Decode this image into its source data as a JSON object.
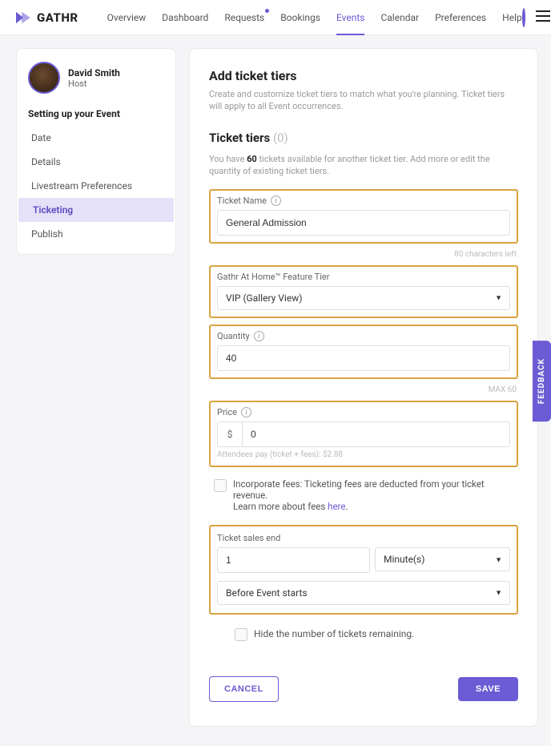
{
  "brand": "GATHR",
  "nav": {
    "overview": "Overview",
    "dashboard": "Dashboard",
    "requests": "Requests",
    "bookings": "Bookings",
    "events": "Events",
    "calendar": "Calendar",
    "preferences": "Preferences",
    "help": "Help"
  },
  "sidebar": {
    "user_name": "David Smith",
    "user_role": "Host",
    "heading": "Setting up your Event",
    "items": {
      "date": "Date",
      "details": "Details",
      "livestream": "Livestream Preferences",
      "ticketing": "Ticketing",
      "publish": "Publish"
    }
  },
  "main": {
    "title": "Add ticket tiers",
    "subtitle": "Create and customize ticket tiers to match what you're planning. Ticket tiers will apply to all Event occurrences.",
    "tiers_label": "Ticket tiers",
    "tiers_count": "(0)",
    "avail_pre": "You have ",
    "avail_num": "60",
    "avail_post": " tickets available for another ticket tier. Add more or edit the quantity of existing ticket tiers.",
    "ticket_name_label": "Ticket Name",
    "ticket_name_value": "General Admission",
    "ticket_name_hint": "80 characters left",
    "feature_tier_label": "Gathr At Home™ Feature Tier",
    "feature_tier_value": "VIP (Gallery View)",
    "quantity_label": "Quantity",
    "quantity_value": "40",
    "quantity_hint": "MAX 60",
    "price_label": "Price",
    "price_symbol": "$",
    "price_value": "0",
    "price_fine": "Attendees pay (ticket + fees): $2.88",
    "fees_text_1": "Incorporate fees: Ticketing fees are deducted from your ticket revenue.",
    "fees_text_2": "Learn more about fees ",
    "fees_link": "here",
    "fees_dot": ".",
    "sales_end_label": "Ticket sales end",
    "sales_num": "1",
    "sales_unit": "Minute(s)",
    "sales_when": "Before Event starts",
    "hide_label": "Hide the number of tickets remaining.",
    "cancel": "CANCEL",
    "save": "SAVE"
  },
  "feedback": "FEEDBACK"
}
